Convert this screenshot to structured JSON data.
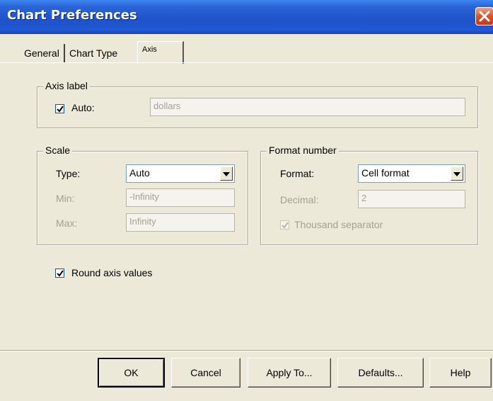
{
  "window": {
    "title": "Chart Preferences"
  },
  "tabs": [
    {
      "label": "General",
      "active": false
    },
    {
      "label": "Chart Type",
      "active": false
    },
    {
      "label": "Axis",
      "active": true
    }
  ],
  "axis_label": {
    "group_title": "Axis label",
    "auto_label": "Auto:",
    "auto_checked": true,
    "value": "dollars"
  },
  "scale": {
    "group_title": "Scale",
    "type_label": "Type:",
    "type_value": "Auto",
    "min_label": "Min:",
    "min_value": "-Infinity",
    "max_label": "Max:",
    "max_value": "Infinity"
  },
  "format_number": {
    "group_title": "Format number",
    "format_label": "Format:",
    "format_value": "Cell format",
    "decimal_label": "Decimal:",
    "decimal_value": "2",
    "thousand_label": "Thousand separator",
    "thousand_checked": true
  },
  "round_axis": {
    "label": "Round axis values",
    "checked": true
  },
  "buttons": {
    "ok": "OK",
    "cancel": "Cancel",
    "apply_to": "Apply To...",
    "defaults": "Defaults...",
    "help": "Help"
  },
  "colors": {
    "titlebar": "#1f52c9",
    "dialog_bg": "#ece9d8",
    "close_button": "#d8522c"
  },
  "icons": {
    "close": "close-icon",
    "check": "checkmark-icon",
    "dropdown": "chevron-down-icon"
  }
}
